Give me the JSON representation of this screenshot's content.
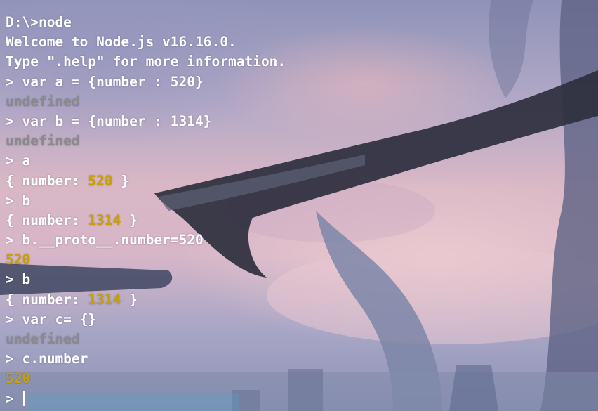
{
  "terminal": {
    "lines": [
      {
        "type": "text",
        "text": "D:\\>node"
      },
      {
        "type": "text",
        "text": "Welcome to Node.js v16.16.0."
      },
      {
        "type": "text",
        "text": "Type \".help\" for more information."
      },
      {
        "type": "text",
        "text": "> var a = {number : 520}"
      },
      {
        "type": "gray",
        "text": "undefined"
      },
      {
        "type": "text",
        "text": "> var b = {number : 1314}"
      },
      {
        "type": "gray",
        "text": "undefined"
      },
      {
        "type": "text",
        "text": "> a"
      },
      {
        "type": "obj",
        "prefix": "{ number: ",
        "value": "520",
        "suffix": " }"
      },
      {
        "type": "text",
        "text": "> b"
      },
      {
        "type": "obj",
        "prefix": "{ number: ",
        "value": "1314",
        "suffix": " }"
      },
      {
        "type": "text",
        "text": "> b.__proto__.number=520"
      },
      {
        "type": "num",
        "text": "520"
      },
      {
        "type": "text",
        "text": "> b"
      },
      {
        "type": "obj",
        "prefix": "{ number: ",
        "value": "1314",
        "suffix": " }"
      },
      {
        "type": "text",
        "text": "> var c= {}"
      },
      {
        "type": "gray",
        "text": "undefined"
      },
      {
        "type": "text",
        "text": "> c.number"
      },
      {
        "type": "num",
        "text": "520"
      }
    ],
    "prompt": "> ",
    "colors": {
      "text": "#ffffff",
      "undefined": "#8a8a8a",
      "number": "#c8a000"
    }
  }
}
